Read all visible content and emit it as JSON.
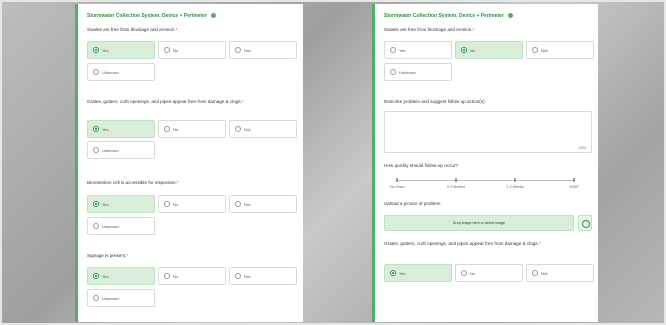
{
  "section_title": "Stormwater Collection System, Device + Perimeter",
  "options": {
    "yes": "Yes",
    "no": "No",
    "na": "N/A",
    "unknown": "Unknown"
  },
  "left": {
    "questions": [
      {
        "text": "Swales are free from blockage and erosion.",
        "selected": "yes"
      },
      {
        "text": "Grates, gutters, curb openings, and pipes appear free from damage & clogs.",
        "selected": "yes"
      },
      {
        "text": "Bioretention cell is accessible for inspection.",
        "selected": "yes"
      },
      {
        "text": "Signage is present.",
        "selected": "yes"
      }
    ]
  },
  "right": {
    "q1": {
      "text": "Swales are free from blockage and erosion.",
      "selected": "no"
    },
    "describe_label": "Describe problem and suggest follow up action(s)",
    "char_count": "1000",
    "followup_label": "How quickly should follow-up occur?",
    "followup_stops": [
      "Too Rush",
      "2-3 Months",
      "2-3 Weeks",
      "ASAP"
    ],
    "upload_label": "Upload a picture of problem",
    "upload_text": "Drop image here or select image",
    "q2": {
      "text": "Grates, gutters, curb openings, and pipes appear free from damage & clogs.",
      "selected": "yes"
    }
  }
}
